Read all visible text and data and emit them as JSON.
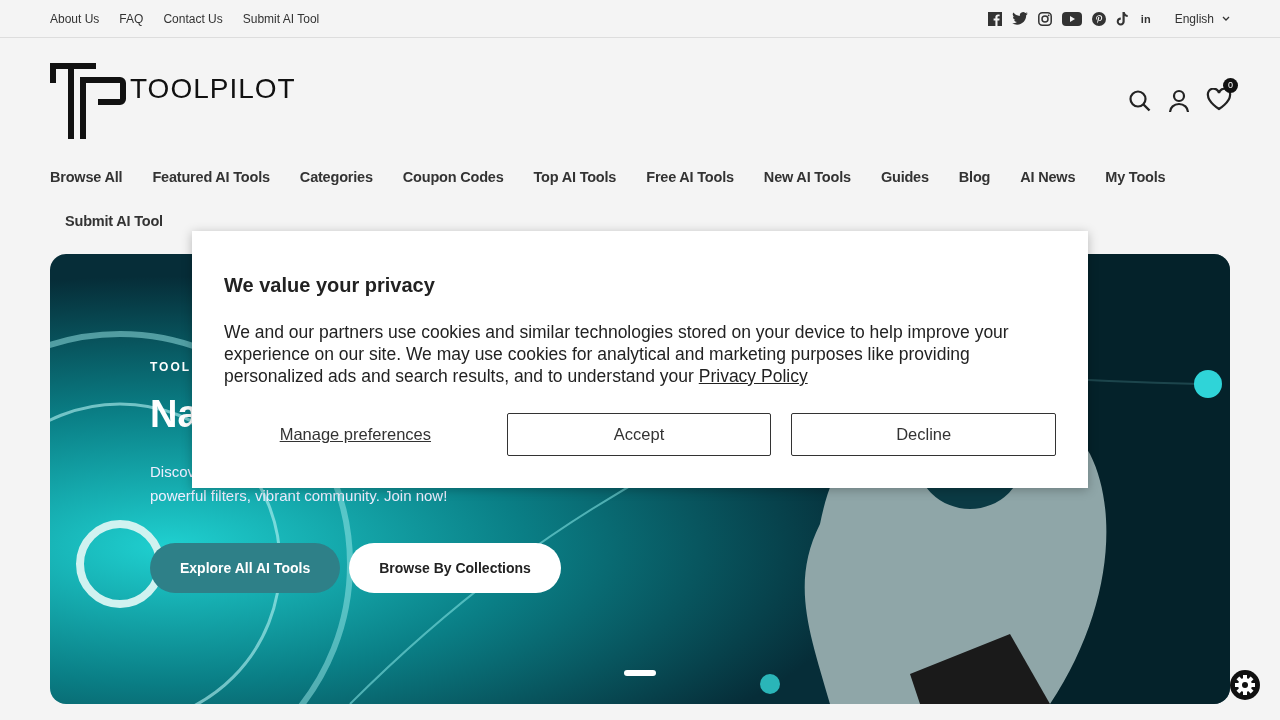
{
  "top_links": [
    "About Us",
    "FAQ",
    "Contact Us",
    "Submit AI Tool"
  ],
  "socials": [
    {
      "kind": "facebook"
    },
    {
      "kind": "twitter"
    },
    {
      "kind": "instagram"
    },
    {
      "kind": "youtube"
    },
    {
      "kind": "pinterest"
    },
    {
      "kind": "tiktok"
    },
    {
      "kind": "linkedin",
      "glyph": "in"
    }
  ],
  "language": "English",
  "logo_text": "TOOLPILOT",
  "wishlist_count": "0",
  "nav": [
    "Browse All",
    "Featured AI Tools",
    "Categories",
    "Coupon Codes",
    "Top AI Tools",
    "Free AI Tools",
    "New AI Tools",
    "Guides",
    "Blog",
    "AI News",
    "My Tools",
    "Submit AI Tool"
  ],
  "hero": {
    "kicker": "TOOL",
    "heading": "Na",
    "text_lines": [
      "Discov",
      "powerful filters, vibrant community. Join now!"
    ],
    "buttons": [
      {
        "label": "Explore All AI Tools",
        "kind": "primary"
      },
      {
        "label": "Browse By Collections",
        "kind": "secondary"
      }
    ],
    "slides": [
      {
        "selected": true
      }
    ]
  },
  "cookie": {
    "title": "We value your privacy",
    "text": "We and our partners use cookies and similar technologies stored on your device to help improve your experience on our site. We may use cookies for analytical and marketing purposes like providing personalized ads and search results, and to understand your",
    "link": "Privacy Policy",
    "buttons": [
      {
        "label": "Manage preferences",
        "kind": "link"
      },
      {
        "label": "Accept",
        "kind": "outline"
      },
      {
        "label": "Decline",
        "kind": "outline"
      }
    ]
  }
}
